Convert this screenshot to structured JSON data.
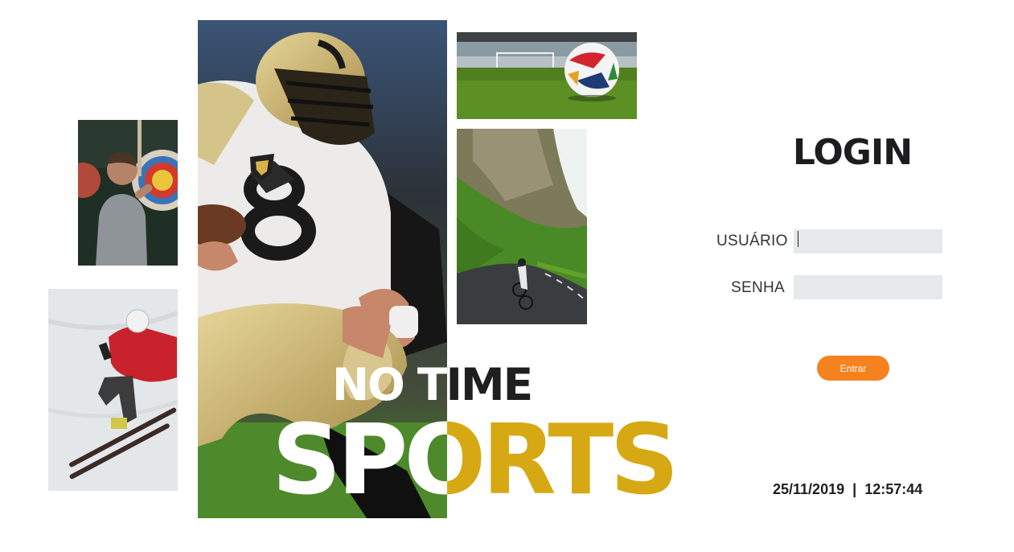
{
  "brand": {
    "line1": "NO TIME",
    "line2": "SPORTS",
    "accent_color": "#d6a914"
  },
  "login": {
    "title": "LOGIN",
    "user_label": "USUÁRIO",
    "password_label": "SENHA",
    "user_value": "",
    "password_value": "",
    "submit_label": "Entrar",
    "button_color": "#f5821f"
  },
  "status": {
    "date": "25/11/2019",
    "separator": "|",
    "time": "12:57:44"
  }
}
